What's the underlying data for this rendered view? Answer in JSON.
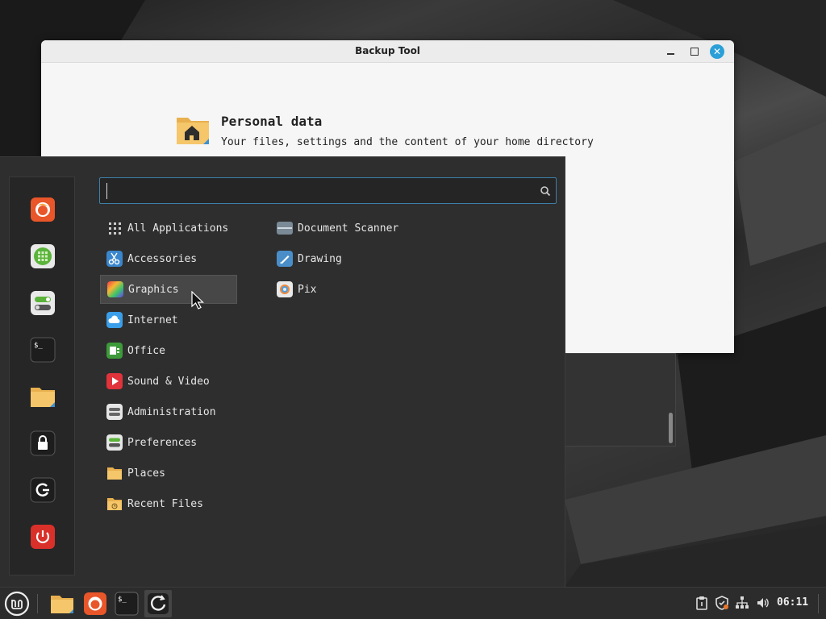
{
  "window": {
    "title": "Backup Tool",
    "close_glyph": "✕",
    "section_title": "Personal data",
    "section_desc": "Your files, settings and the content of your home directory"
  },
  "menu": {
    "search_placeholder": "",
    "categories": [
      {
        "label": "All Applications",
        "icon": "grid-icon"
      },
      {
        "label": "Accessories",
        "icon": "scissors-icon"
      },
      {
        "label": "Graphics",
        "icon": "graphics-icon",
        "selected": true
      },
      {
        "label": "Internet",
        "icon": "cloud-icon"
      },
      {
        "label": "Office",
        "icon": "office-icon"
      },
      {
        "label": "Sound & Video",
        "icon": "play-icon"
      },
      {
        "label": "Administration",
        "icon": "admin-icon"
      },
      {
        "label": "Preferences",
        "icon": "preferences-icon"
      },
      {
        "label": "Places",
        "icon": "folder-icon"
      },
      {
        "label": "Recent Files",
        "icon": "recent-folder-icon"
      }
    ],
    "apps": [
      {
        "label": "Document Scanner",
        "icon": "scanner-icon"
      },
      {
        "label": "Drawing",
        "icon": "drawing-icon"
      },
      {
        "label": "Pix",
        "icon": "pix-icon"
      }
    ],
    "favorites": [
      "firefox-icon",
      "calculator-icon",
      "settings-toggle-icon",
      "terminal-icon",
      "folder-icon",
      "lock-icon",
      "logout-icon",
      "power-icon"
    ]
  },
  "taskbar": {
    "clock": "06:11",
    "items": [
      "mint-menu-icon",
      "files-icon",
      "firefox-icon",
      "terminal-icon",
      "backup-icon"
    ],
    "tray": [
      "clipboard-icon",
      "shield-icon",
      "network-icon",
      "volume-icon"
    ]
  },
  "colors": {
    "accent": "#2a9fd8",
    "menu_bg": "#2e2e2e",
    "selected_bg": "#474747"
  }
}
